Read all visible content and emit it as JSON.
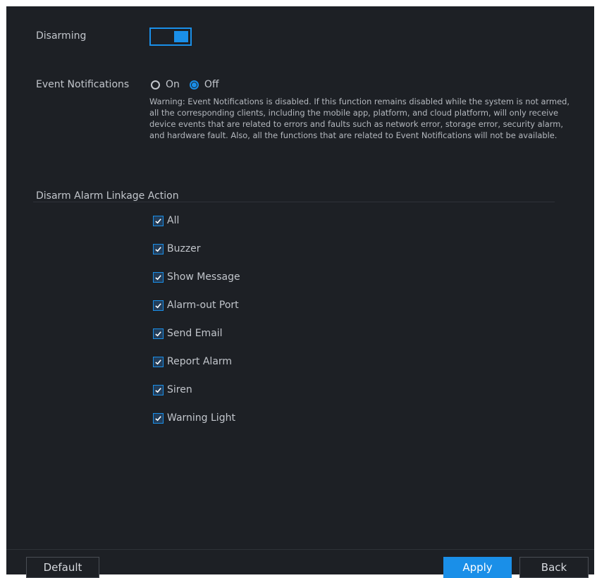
{
  "disarming": {
    "label": "Disarming",
    "enabled": true
  },
  "event_notifications": {
    "label": "Event Notifications",
    "options": [
      {
        "label": "On",
        "selected": false
      },
      {
        "label": "Off",
        "selected": true
      }
    ],
    "warning": "Warning: Event Notifications is disabled. If this function remains disabled while the system is not armed, all the corresponding clients, including the mobile app, platform, and cloud platform, will only receive device events that are related to errors and faults such as network error, storage error, security alarm, and hardware fault. Also, all the functions that are related to Event Notifications will not be available."
  },
  "linkage": {
    "title": "Disarm Alarm Linkage Action",
    "items": [
      {
        "label": "All",
        "checked": true
      },
      {
        "label": "Buzzer",
        "checked": true
      },
      {
        "label": "Show Message",
        "checked": true
      },
      {
        "label": "Alarm-out Port",
        "checked": true
      },
      {
        "label": "Send Email",
        "checked": true
      },
      {
        "label": "Report Alarm",
        "checked": true
      },
      {
        "label": "Siren",
        "checked": true
      },
      {
        "label": "Warning Light",
        "checked": true
      }
    ]
  },
  "footer": {
    "default_label": "Default",
    "apply_label": "Apply",
    "back_label": "Back"
  },
  "colors": {
    "accent": "#1a8fe8",
    "background": "#1d2025",
    "text": "#c2c6cc"
  }
}
